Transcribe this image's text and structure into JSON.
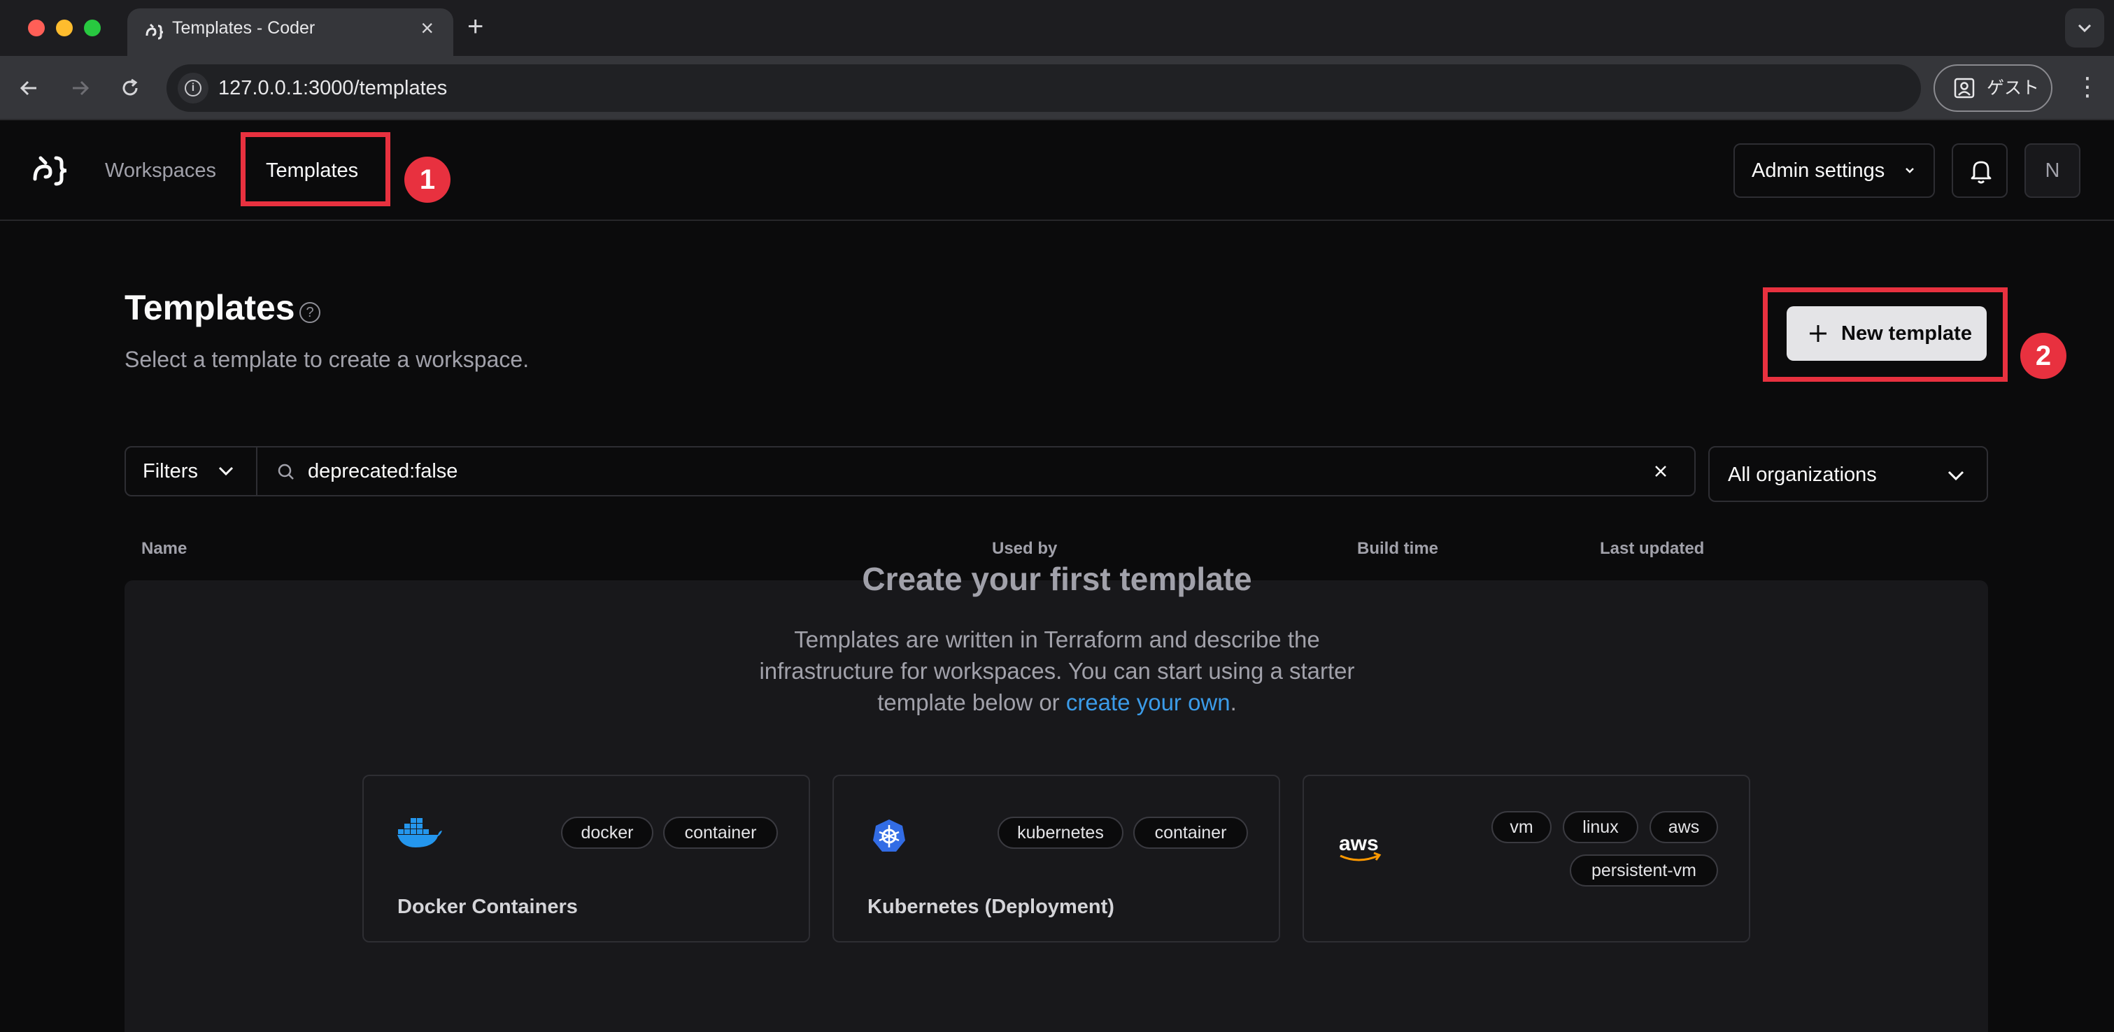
{
  "browser": {
    "tab_title": "Templates - Coder",
    "url": "127.0.0.1:3000/templates",
    "profile_label": "ゲスト"
  },
  "appbar": {
    "nav": [
      {
        "label": "Workspaces"
      },
      {
        "label": "Templates"
      }
    ],
    "admin_settings_label": "Admin settings",
    "avatar_initial": "N"
  },
  "annotations": {
    "badge_1": "1",
    "badge_2": "2",
    "highlight_color": "#e8313f"
  },
  "page": {
    "title": "Templates",
    "subtitle": "Select a template to create a workspace.",
    "new_template_label": "New template"
  },
  "filters": {
    "filters_label": "Filters",
    "search_value": "deprecated:false",
    "org_select_value": "All organizations"
  },
  "table": {
    "columns": [
      "Name",
      "Used by",
      "Build time",
      "Last updated"
    ]
  },
  "empty_state": {
    "title": "Create your first template",
    "desc_part1": "Templates are written in Terraform and describe the infrastructure for workspaces. You can start using a starter template below or ",
    "link_text": "create your own",
    "desc_part2": "."
  },
  "starter_templates": [
    {
      "title": "Docker Containers",
      "icon": "docker-icon",
      "tags": [
        "docker",
        "container"
      ]
    },
    {
      "title": "Kubernetes (Deployment)",
      "icon": "kubernetes-icon",
      "tags": [
        "kubernetes",
        "container"
      ]
    },
    {
      "title": "",
      "icon": "aws-icon",
      "tags": [
        "vm",
        "linux",
        "aws",
        "persistent-vm"
      ]
    }
  ],
  "colors": {
    "background": "#0b0b0c",
    "panel": "#18181b",
    "accent_link": "#3b9be8",
    "primary_button": "#e4e4e7"
  }
}
